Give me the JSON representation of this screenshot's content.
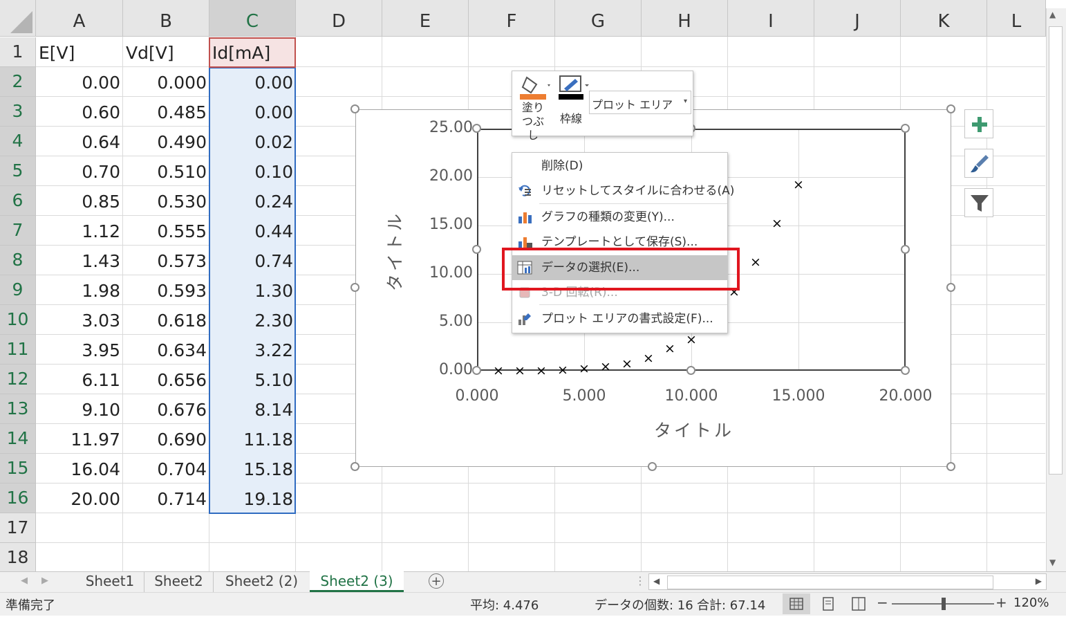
{
  "columns": [
    "A",
    "B",
    "C",
    "D",
    "E",
    "F",
    "G",
    "H",
    "I",
    "J",
    "K",
    "L"
  ],
  "rows": [
    "1",
    "2",
    "3",
    "4",
    "5",
    "6",
    "7",
    "8",
    "9",
    "10",
    "11",
    "12",
    "13",
    "14",
    "15",
    "16",
    "17",
    "18"
  ],
  "headers": [
    "E[V]",
    "Vd[V]",
    "Id[mA]"
  ],
  "data": [
    [
      "0.00",
      "0.000",
      "0.00"
    ],
    [
      "0.60",
      "0.485",
      "0.00"
    ],
    [
      "0.64",
      "0.490",
      "0.02"
    ],
    [
      "0.70",
      "0.510",
      "0.10"
    ],
    [
      "0.85",
      "0.530",
      "0.24"
    ],
    [
      "1.12",
      "0.555",
      "0.44"
    ],
    [
      "1.43",
      "0.573",
      "0.74"
    ],
    [
      "1.98",
      "0.593",
      "1.30"
    ],
    [
      "3.03",
      "0.618",
      "2.30"
    ],
    [
      "3.95",
      "0.634",
      "3.22"
    ],
    [
      "6.11",
      "0.656",
      "5.10"
    ],
    [
      "9.10",
      "0.676",
      "8.14"
    ],
    [
      "11.97",
      "0.690",
      "11.18"
    ],
    [
      "16.04",
      "0.704",
      "15.18"
    ],
    [
      "20.00",
      "0.714",
      "19.18"
    ]
  ],
  "mini_toolbar": {
    "fill_label": "塗りつぶし",
    "outline_label": "枠線",
    "element_select": "プロット エリア"
  },
  "context_menu": {
    "items": [
      {
        "label": "削除(D)",
        "icon": "none",
        "enabled": true
      },
      {
        "label": "リセットしてスタイルに合わせる(A)",
        "icon": "reset-style-icon",
        "enabled": true
      },
      {
        "label": "グラフの種類の変更(Y)...",
        "icon": "chart-type-icon",
        "enabled": true
      },
      {
        "label": "テンプレートとして保存(S)...",
        "icon": "save-template-icon",
        "enabled": true
      },
      {
        "label": "データの選択(E)...",
        "icon": "select-data-icon",
        "enabled": true,
        "highlighted": true
      },
      {
        "label": "3-D 回転(R)...",
        "icon": "rotate-3d-icon",
        "enabled": false
      },
      {
        "label": "プロット エリアの書式設定(F)...",
        "icon": "format-plot-area-icon",
        "enabled": true
      }
    ]
  },
  "chart_data": {
    "type": "scatter",
    "title": "",
    "xlabel": "タイトル",
    "ylabel": "タイトル",
    "xlim": [
      0,
      20
    ],
    "ylim": [
      0,
      25
    ],
    "x_ticks": [
      "0.000",
      "5.000",
      "10.000",
      "15.000",
      "20.000"
    ],
    "y_ticks": [
      "0.00",
      "5.00",
      "10.00",
      "15.00",
      "20.00",
      "25.00"
    ],
    "grid": true,
    "marker": "x",
    "series": [
      {
        "x": [
          1,
          2,
          3,
          4,
          5,
          6,
          7,
          8,
          9,
          10,
          11,
          12,
          13,
          14,
          15
        ],
        "y": [
          0.0,
          0.0,
          0.02,
          0.1,
          0.24,
          0.44,
          0.74,
          1.3,
          2.3,
          3.22,
          5.1,
          8.14,
          11.18,
          15.18,
          19.18
        ]
      }
    ]
  },
  "sheet_tabs": [
    "Sheet1",
    "Sheet2",
    "Sheet2 (2)",
    "Sheet2 (3)"
  ],
  "active_tab": "Sheet2 (3)",
  "status": {
    "ready": "準備完了",
    "average": "平均: 4.476",
    "count": "データの個数: 16",
    "sum": "合計: 67.14",
    "zoom": "120%"
  },
  "colors": {
    "excel_green": "#217346",
    "selection_blue": "#2f6bc1",
    "highlight_red": "#e0161f",
    "fill_orange": "#ed7d31"
  }
}
